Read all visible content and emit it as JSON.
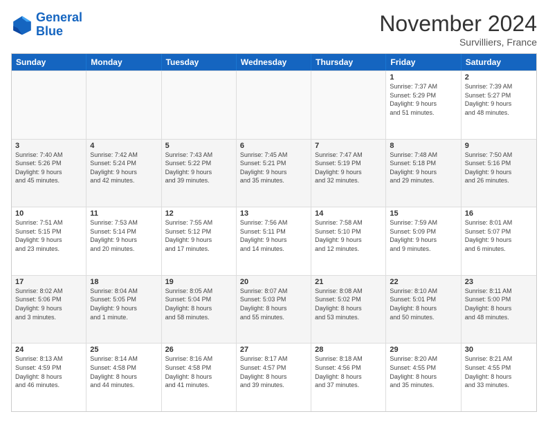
{
  "logo": {
    "line1": "General",
    "line2": "Blue"
  },
  "title": "November 2024",
  "subtitle": "Survilliers, France",
  "days": [
    "Sunday",
    "Monday",
    "Tuesday",
    "Wednesday",
    "Thursday",
    "Friday",
    "Saturday"
  ],
  "weeks": [
    [
      {
        "date": "",
        "info": ""
      },
      {
        "date": "",
        "info": ""
      },
      {
        "date": "",
        "info": ""
      },
      {
        "date": "",
        "info": ""
      },
      {
        "date": "",
        "info": ""
      },
      {
        "date": "1",
        "info": "Sunrise: 7:37 AM\nSunset: 5:29 PM\nDaylight: 9 hours\nand 51 minutes."
      },
      {
        "date": "2",
        "info": "Sunrise: 7:39 AM\nSunset: 5:27 PM\nDaylight: 9 hours\nand 48 minutes."
      }
    ],
    [
      {
        "date": "3",
        "info": "Sunrise: 7:40 AM\nSunset: 5:26 PM\nDaylight: 9 hours\nand 45 minutes."
      },
      {
        "date": "4",
        "info": "Sunrise: 7:42 AM\nSunset: 5:24 PM\nDaylight: 9 hours\nand 42 minutes."
      },
      {
        "date": "5",
        "info": "Sunrise: 7:43 AM\nSunset: 5:22 PM\nDaylight: 9 hours\nand 39 minutes."
      },
      {
        "date": "6",
        "info": "Sunrise: 7:45 AM\nSunset: 5:21 PM\nDaylight: 9 hours\nand 35 minutes."
      },
      {
        "date": "7",
        "info": "Sunrise: 7:47 AM\nSunset: 5:19 PM\nDaylight: 9 hours\nand 32 minutes."
      },
      {
        "date": "8",
        "info": "Sunrise: 7:48 AM\nSunset: 5:18 PM\nDaylight: 9 hours\nand 29 minutes."
      },
      {
        "date": "9",
        "info": "Sunrise: 7:50 AM\nSunset: 5:16 PM\nDaylight: 9 hours\nand 26 minutes."
      }
    ],
    [
      {
        "date": "10",
        "info": "Sunrise: 7:51 AM\nSunset: 5:15 PM\nDaylight: 9 hours\nand 23 minutes."
      },
      {
        "date": "11",
        "info": "Sunrise: 7:53 AM\nSunset: 5:14 PM\nDaylight: 9 hours\nand 20 minutes."
      },
      {
        "date": "12",
        "info": "Sunrise: 7:55 AM\nSunset: 5:12 PM\nDaylight: 9 hours\nand 17 minutes."
      },
      {
        "date": "13",
        "info": "Sunrise: 7:56 AM\nSunset: 5:11 PM\nDaylight: 9 hours\nand 14 minutes."
      },
      {
        "date": "14",
        "info": "Sunrise: 7:58 AM\nSunset: 5:10 PM\nDaylight: 9 hours\nand 12 minutes."
      },
      {
        "date": "15",
        "info": "Sunrise: 7:59 AM\nSunset: 5:09 PM\nDaylight: 9 hours\nand 9 minutes."
      },
      {
        "date": "16",
        "info": "Sunrise: 8:01 AM\nSunset: 5:07 PM\nDaylight: 9 hours\nand 6 minutes."
      }
    ],
    [
      {
        "date": "17",
        "info": "Sunrise: 8:02 AM\nSunset: 5:06 PM\nDaylight: 9 hours\nand 3 minutes."
      },
      {
        "date": "18",
        "info": "Sunrise: 8:04 AM\nSunset: 5:05 PM\nDaylight: 9 hours\nand 1 minute."
      },
      {
        "date": "19",
        "info": "Sunrise: 8:05 AM\nSunset: 5:04 PM\nDaylight: 8 hours\nand 58 minutes."
      },
      {
        "date": "20",
        "info": "Sunrise: 8:07 AM\nSunset: 5:03 PM\nDaylight: 8 hours\nand 55 minutes."
      },
      {
        "date": "21",
        "info": "Sunrise: 8:08 AM\nSunset: 5:02 PM\nDaylight: 8 hours\nand 53 minutes."
      },
      {
        "date": "22",
        "info": "Sunrise: 8:10 AM\nSunset: 5:01 PM\nDaylight: 8 hours\nand 50 minutes."
      },
      {
        "date": "23",
        "info": "Sunrise: 8:11 AM\nSunset: 5:00 PM\nDaylight: 8 hours\nand 48 minutes."
      }
    ],
    [
      {
        "date": "24",
        "info": "Sunrise: 8:13 AM\nSunset: 4:59 PM\nDaylight: 8 hours\nand 46 minutes."
      },
      {
        "date": "25",
        "info": "Sunrise: 8:14 AM\nSunset: 4:58 PM\nDaylight: 8 hours\nand 44 minutes."
      },
      {
        "date": "26",
        "info": "Sunrise: 8:16 AM\nSunset: 4:58 PM\nDaylight: 8 hours\nand 41 minutes."
      },
      {
        "date": "27",
        "info": "Sunrise: 8:17 AM\nSunset: 4:57 PM\nDaylight: 8 hours\nand 39 minutes."
      },
      {
        "date": "28",
        "info": "Sunrise: 8:18 AM\nSunset: 4:56 PM\nDaylight: 8 hours\nand 37 minutes."
      },
      {
        "date": "29",
        "info": "Sunrise: 8:20 AM\nSunset: 4:55 PM\nDaylight: 8 hours\nand 35 minutes."
      },
      {
        "date": "30",
        "info": "Sunrise: 8:21 AM\nSunset: 4:55 PM\nDaylight: 8 hours\nand 33 minutes."
      }
    ]
  ]
}
